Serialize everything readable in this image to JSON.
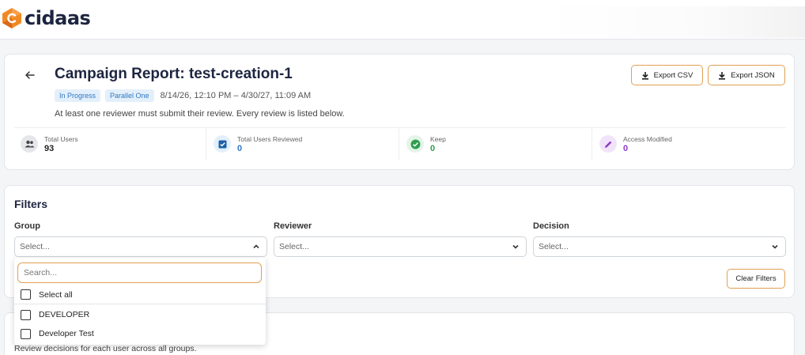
{
  "brand": {
    "name": "cidaas"
  },
  "report": {
    "title": "Campaign Report: test-creation-1",
    "status_tag": "In Progress",
    "type_tag": "Parallel One",
    "date_range": "8/14/26, 12:10 PM – 4/30/27, 11:09 AM",
    "description": "At least one reviewer must submit their review. Every review is listed below.",
    "export_csv_label": "Export CSV",
    "export_json_label": "Export JSON",
    "stats": [
      {
        "label": "Total Users",
        "value": "93",
        "icon": "users-icon",
        "color": "#222222"
      },
      {
        "label": "Total Users Reviewed",
        "value": "0",
        "icon": "check-square-icon",
        "color": "#2f78c2"
      },
      {
        "label": "Keep",
        "value": "0",
        "icon": "check-circle-icon",
        "color": "#2e9e4f"
      },
      {
        "label": "Access Modified",
        "value": "0",
        "icon": "pencil-icon",
        "color": "#8e3cc6"
      }
    ]
  },
  "filters": {
    "title": "Filters",
    "group": {
      "label": "Group",
      "placeholder": "Select..."
    },
    "reviewer": {
      "label": "Reviewer",
      "placeholder": "Select..."
    },
    "decision": {
      "label": "Decision",
      "placeholder": "Select..."
    },
    "clear_label": "Clear Filters",
    "dropdown": {
      "search_placeholder": "Search...",
      "select_all_label": "Select all",
      "options": [
        "DEVELOPER",
        "Developer Test"
      ]
    }
  },
  "decisions": {
    "subtitle": "Review decisions for each user across all groups."
  },
  "colors": {
    "accent": "#e0a052",
    "tag_bg": "#e3f0fb",
    "tag_text": "#2f78c2",
    "title": "#1d2540"
  }
}
